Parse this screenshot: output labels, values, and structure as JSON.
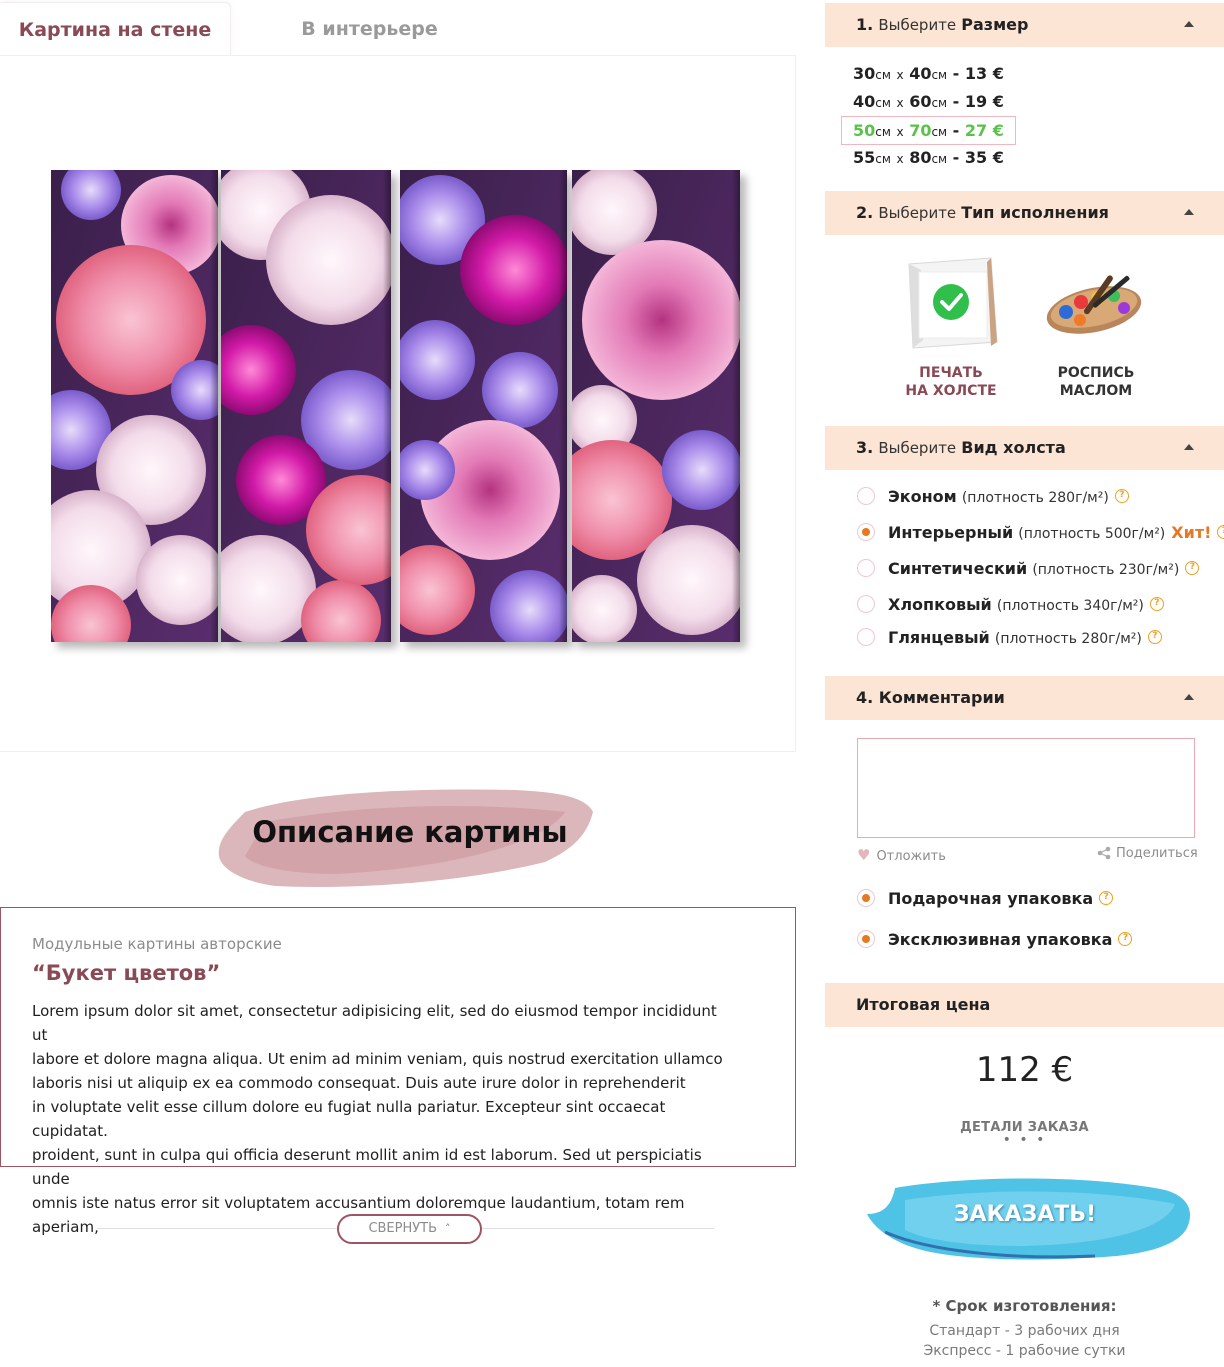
{
  "tabs": {
    "wall": "Картина на стене",
    "interior": "В интерьере"
  },
  "description": {
    "heading": "Описание картины",
    "category": "Модульные картины авторские",
    "name": "“Букет цветов”",
    "lines": [
      "Lorem ipsum dolor sit amet, consectetur adipisicing elit, sed do eiusmod tempor incididunt ut",
      "labore et dolore magna aliqua. Ut enim ad minim veniam, quis nostrud exercitation ullamco",
      "laboris nisi ut aliquip ex ea commodo consequat. Duis aute irure dolor in reprehenderit",
      "in voluptate velit esse cillum dolore eu fugiat nulla pariatur. Excepteur sint occaecat cupidatat.",
      "proident, sunt in culpa qui officia deserunt mollit anim id est laborum. Sed ut perspiciatis unde",
      "omnis iste natus error sit voluptatem accusantium doloremque laudantium, totam rem aperiam,"
    ],
    "collapse": "СВЕРНУТЬ"
  },
  "step1": {
    "num": "1.",
    "pre": "Выберите",
    "title": "Размер",
    "sizes": [
      {
        "w": "30",
        "h": "40",
        "unit": "см",
        "x": "x",
        "sep": " - ",
        "price": "13 €"
      },
      {
        "w": "40",
        "h": "60",
        "unit": "см",
        "x": "x",
        "sep": " - ",
        "price": "19 €"
      },
      {
        "w": "50",
        "h": "70",
        "unit": "см",
        "x": "x",
        "sep": " - ",
        "price": "27 €"
      },
      {
        "w": "55",
        "h": "80",
        "unit": "см",
        "x": "x",
        "sep": " - ",
        "price": "35 €"
      }
    ]
  },
  "step2": {
    "num": "2.",
    "pre": "Выберите",
    "title": "Тип исполнения",
    "types": [
      {
        "line1": "ПЕЧАТЬ",
        "line2": "НА ХОЛСТЕ",
        "icon": "canvas-print-icon"
      },
      {
        "line1": "РОСПИСЬ",
        "line2": "МАСЛОМ",
        "icon": "oil-palette-icon"
      }
    ]
  },
  "step3": {
    "num": "3.",
    "pre": "Выберите",
    "title": "Вид холста",
    "options": [
      {
        "name": "Эконом",
        "density": "(плотность 280г/м²)"
      },
      {
        "name": "Интерьерный",
        "density": "(плотность 500г/м²)",
        "badge": "Хит!"
      },
      {
        "name": "Синтетический",
        "density": "(плотность 230г/м²)"
      },
      {
        "name": "Хлопковый",
        "density": "(плотность 340г/м²)"
      },
      {
        "name": "Глянцевый",
        "density": "(плотность 280г/м²)"
      }
    ]
  },
  "step4": {
    "title": "4. Комментарии",
    "postpone": "Отложить",
    "share": "Поделиться",
    "packaging": [
      "Подарочная упаковка",
      "Эксклюзивная упаковка"
    ]
  },
  "total": {
    "title": "Итоговая цена",
    "price": "112 €",
    "details": "ДЕТАЛИ ЗАКАЗА",
    "dots": "• • •",
    "order": "ЗАКАЗАТЬ!"
  },
  "leadtime": {
    "title": "* Срок изготовления:",
    "standard": "Стандарт - 3 рабочих дня",
    "express": "Экспресс - 1 рабочие сутки"
  },
  "colors": {
    "accent": "#8a4a55",
    "header_bg": "#fde5d5",
    "selected_price": "#5bc249",
    "radio_on": "#e87722",
    "order_brush": "#4fc3e6"
  }
}
